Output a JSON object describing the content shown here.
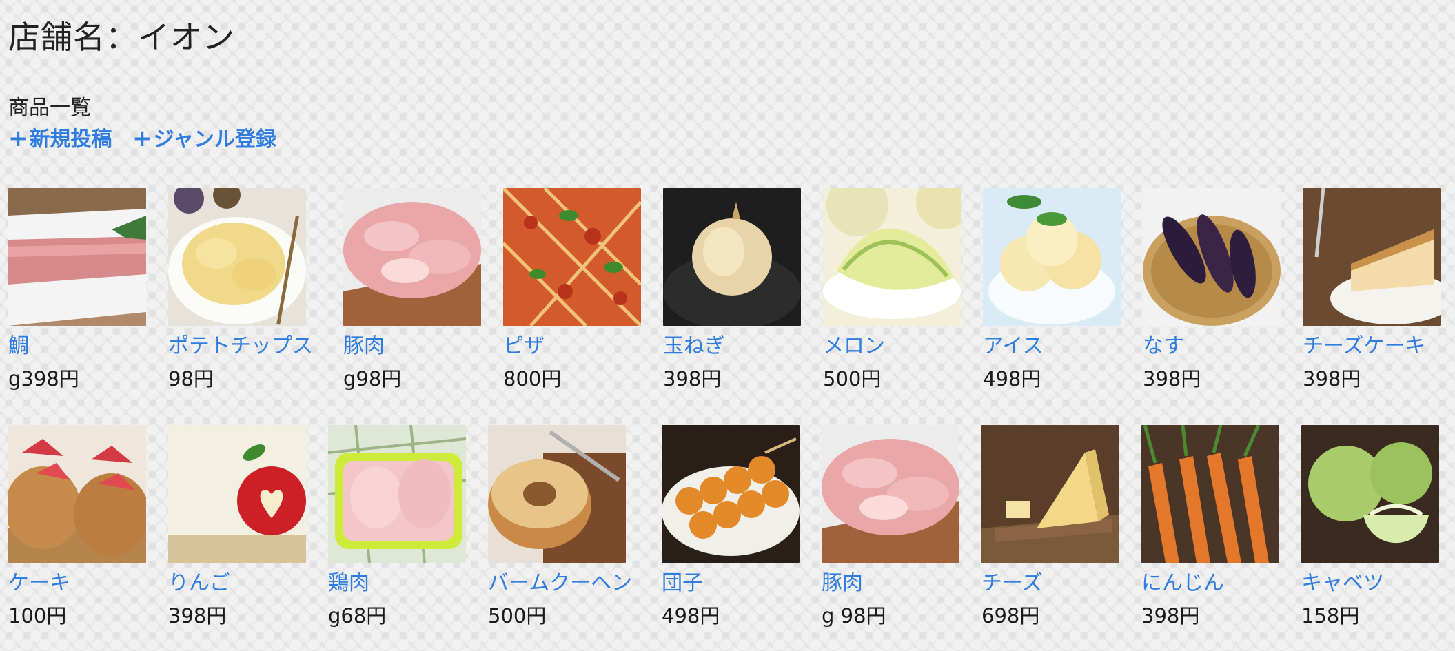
{
  "store": {
    "title": "店舗名：イオン"
  },
  "section": {
    "label": "商品一覧"
  },
  "actions": {
    "new_post": "新規投稿",
    "genre_register": "ジャンル登録"
  },
  "products": [
    {
      "name": "鯛",
      "price": "g398円",
      "image": "sashimi-photo"
    },
    {
      "name": "ポテトチップス",
      "price": "98円",
      "image": "potato-chips-photo"
    },
    {
      "name": "豚肉",
      "price": "g98円",
      "image": "pork-photo"
    },
    {
      "name": "ピザ",
      "price": "800円",
      "image": "pizza-photo"
    },
    {
      "name": "玉ねぎ",
      "price": "398円",
      "image": "onion-photo"
    },
    {
      "name": "メロン",
      "price": "500円",
      "image": "melon-photo"
    },
    {
      "name": "アイス",
      "price": "498円",
      "image": "ice-cream-photo"
    },
    {
      "name": "なす",
      "price": "398円",
      "image": "eggplant-photo"
    },
    {
      "name": "チーズケーキ",
      "price": "398円",
      "image": "cheesecake-photo"
    },
    {
      "name": "ケーキ",
      "price": "100円",
      "image": "strawberry-cake-photo"
    },
    {
      "name": "りんご",
      "price": "398円",
      "image": "apple-photo"
    },
    {
      "name": "鶏肉",
      "price": "g68円",
      "image": "chicken-photo"
    },
    {
      "name": "バームクーヘン",
      "price": "500円",
      "image": "baumkuchen-photo"
    },
    {
      "name": "団子",
      "price": "498円",
      "image": "dango-photo"
    },
    {
      "name": "豚肉",
      "price": "g 98円",
      "image": "pork-photo"
    },
    {
      "name": "チーズ",
      "price": "698円",
      "image": "cheese-photo"
    },
    {
      "name": "にんじん",
      "price": "398円",
      "image": "carrot-photo"
    },
    {
      "name": "キャベツ",
      "price": "158円",
      "image": "cabbage-photo"
    }
  ]
}
